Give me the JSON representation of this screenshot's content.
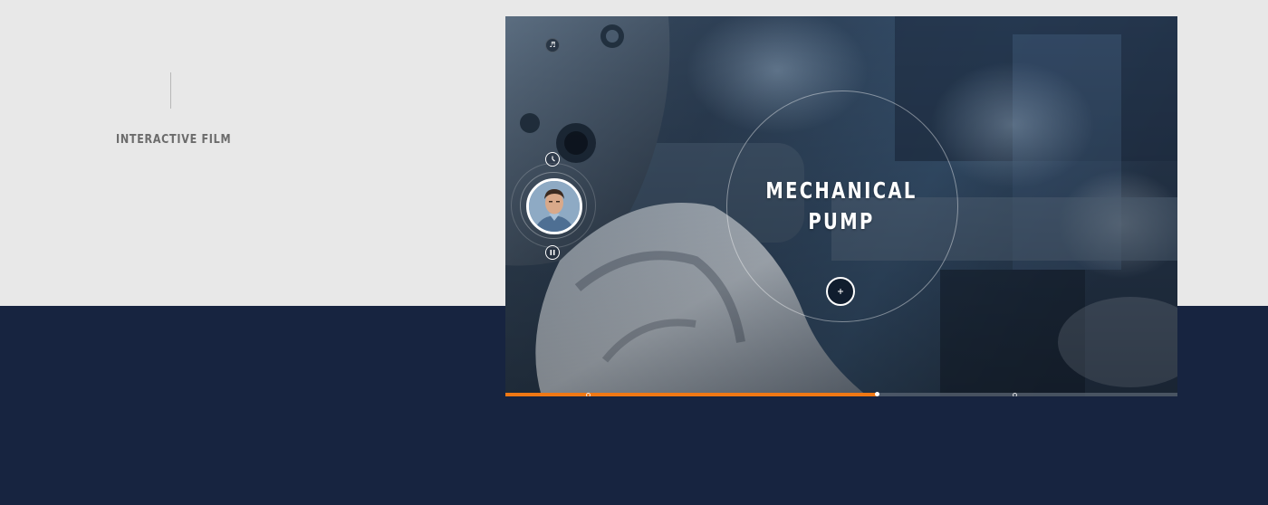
{
  "section": {
    "label": "INTERACTIVE FILM"
  },
  "video": {
    "title_lines": [
      "MECHANICAL",
      "PUMP"
    ],
    "progress_fraction": 0.552,
    "chapter_markers": [
      0.122,
      0.757
    ],
    "icons": {
      "sound": "speaker-icon",
      "clock": "clock-icon",
      "pause": "pause-icon",
      "hotspot": "plus-icon",
      "presenter": "presenter-avatar"
    }
  },
  "colors": {
    "page_bg": "#e8e8e8",
    "band_bg": "#172440",
    "progress_accent": "#f07814",
    "label_text": "#6b6b6b"
  }
}
